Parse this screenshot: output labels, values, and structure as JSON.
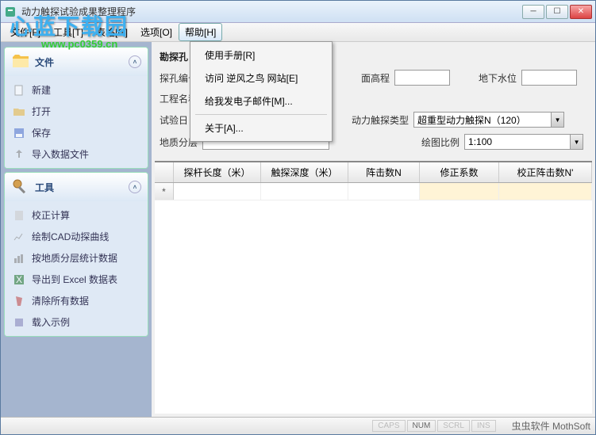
{
  "window": {
    "title": "动力触探试验成果整理程序"
  },
  "menubar": {
    "items": [
      {
        "label": "文件[F]"
      },
      {
        "label": "工具[T]"
      },
      {
        "label": "表格[G]"
      },
      {
        "label": "选项[O]"
      },
      {
        "label": "帮助[H]"
      }
    ]
  },
  "help_menu": {
    "items": [
      "使用手册[R]",
      "访问 逆风之鸟 网站[E]",
      "给我发电子邮件[M]...",
      "关于[A]..."
    ]
  },
  "sidebar": {
    "file": {
      "title": "文件",
      "items": [
        "新建",
        "打开",
        "保存",
        "导入数据文件"
      ]
    },
    "tool": {
      "title": "工具",
      "items": [
        "校正计算",
        "绘制CAD动探曲线",
        "按地质分层统计数据",
        "导出到 Excel 数据表",
        "清除所有数据",
        "载入示例"
      ]
    }
  },
  "form": {
    "section": "勘探孔",
    "labels": {
      "holeNo": "探孔编号",
      "surfaceElev": "面高程",
      "groundwater": "地下水位",
      "projName": "工程名称",
      "testDate": "试验日",
      "probeType": "动力触探类型",
      "geoLayer": "地质分层",
      "plotScale": "绘图比例"
    },
    "values": {
      "probeType": "超重型动力触探N（120）",
      "plotScale": "1:100"
    }
  },
  "grid": {
    "columns": [
      "探杆长度（米）",
      "触探深度（米）",
      "阵击数N",
      "修正系数",
      "校正阵击数N'"
    ],
    "rowmarker": "*"
  },
  "status": {
    "indicators": [
      "CAPS",
      "NUM",
      "SCRL",
      "INS"
    ],
    "brand": "虫虫软件 MothSoft"
  },
  "watermark": {
    "line1": "心蓝下载园",
    "line2": "www.pc0359.cn"
  }
}
